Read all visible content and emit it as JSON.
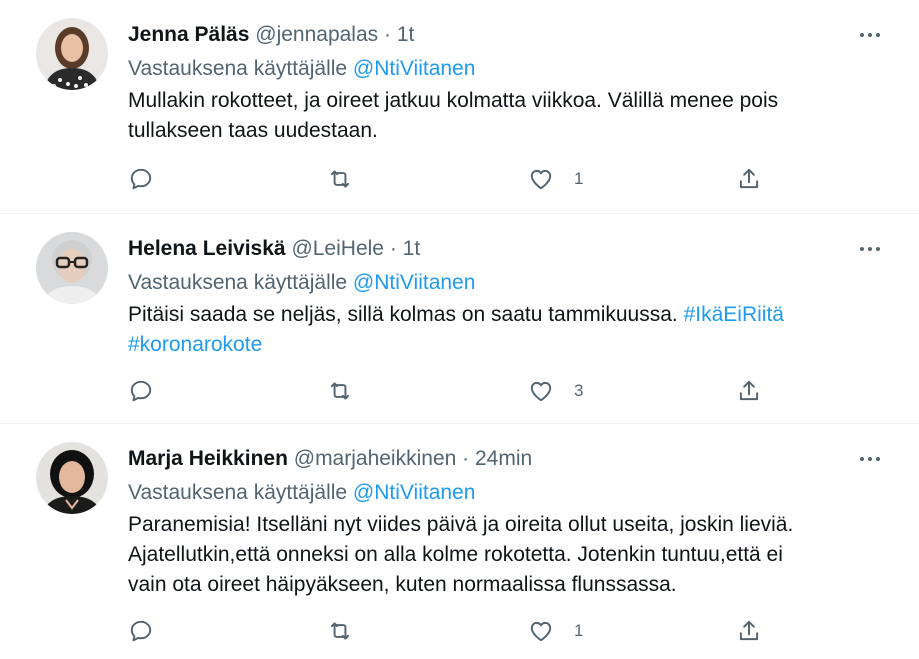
{
  "tweets": [
    {
      "name": "Jenna Päläs",
      "handle": "@jennapalas",
      "dot": "·",
      "time": "1t",
      "reply_prefix": "Vastauksena käyttäjälle",
      "reply_to": "@NtiViitanen",
      "text_lines": [
        "Mullakin rokotteet, ja oireet jatkuu kolmatta viikkoa. Välillä menee pois",
        "tullakseen taas uudestaan."
      ],
      "like_count": "1"
    },
    {
      "name": "Helena Leiviskä",
      "handle": "@LeiHele",
      "dot": "·",
      "time": "1t",
      "reply_prefix": "Vastauksena käyttäjälle",
      "reply_to": "@NtiViitanen",
      "text_line1": "Pitäisi saada se neljäs, sillä kolmas on saatu tammikuussa.",
      "hashtag1": "#IkäEiRiitä",
      "hashtag2": "#koronarokote",
      "like_count": "3"
    },
    {
      "name": "Marja Heikkinen",
      "handle": "@marjaheikkinen",
      "dot": "·",
      "time": "24min",
      "reply_prefix": "Vastauksena käyttäjälle",
      "reply_to": "@NtiViitanen",
      "text_lines": [
        "Paranemisia! Itselläni nyt viides päivä ja oireita ollut useita, joskin lieviä.",
        "Ajatellutkin,että onneksi on alla kolme rokotetta. Jotenkin tuntuu,että ei",
        "vain ota oireet häipyäkseen, kuten normaalissa flunssassa."
      ],
      "like_count": "1"
    }
  ],
  "icons": {
    "reply": "speech-bubble",
    "retweet": "retweet-arrows",
    "like": "heart-outline",
    "share": "share-upload-arrow",
    "more": "three-dots"
  },
  "colors": {
    "text": "#0f1419",
    "secondary": "#536471",
    "link": "#1d9bf0",
    "divider": "#eff3f4"
  }
}
